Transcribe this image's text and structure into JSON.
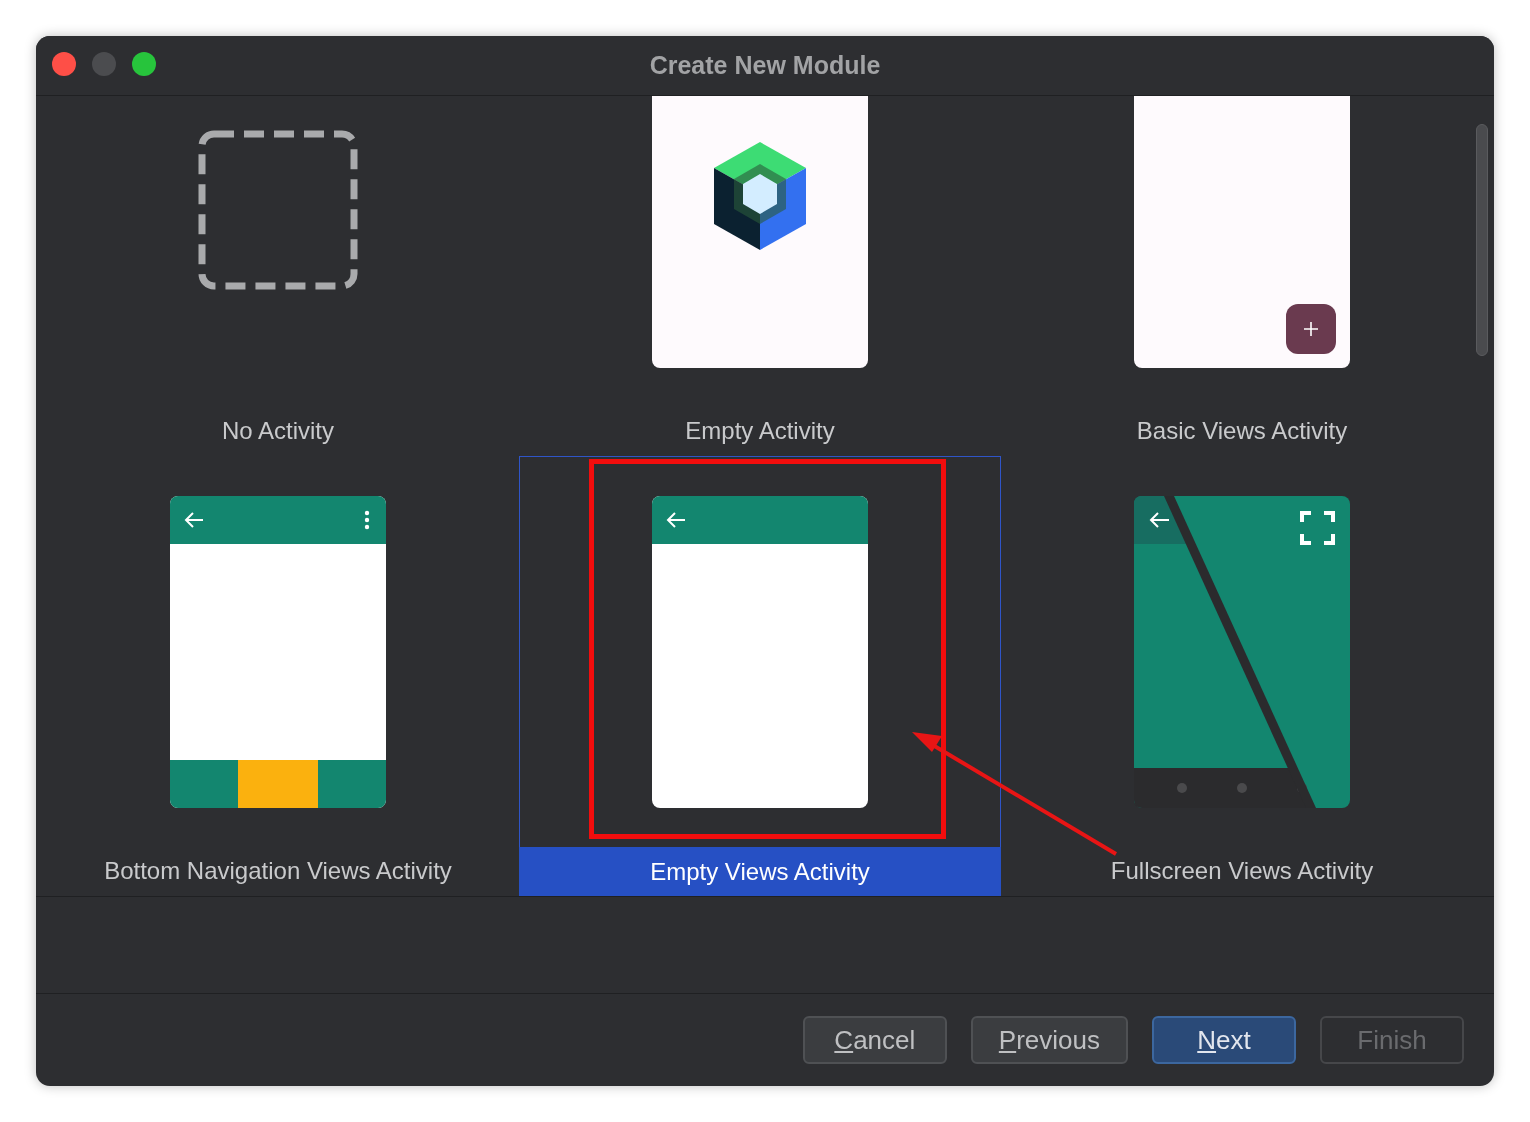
{
  "window": {
    "title": "Create New Module"
  },
  "templates": [
    {
      "name": "No Activity",
      "kind": "none",
      "selected": false
    },
    {
      "name": "Empty Activity",
      "kind": "compose",
      "selected": false
    },
    {
      "name": "Basic Views Activity",
      "kind": "fab",
      "selected": false
    },
    {
      "name": "Bottom Navigation Views Activity",
      "kind": "bottom-nav",
      "selected": false
    },
    {
      "name": "Empty Views Activity",
      "kind": "app-bar",
      "selected": true
    },
    {
      "name": "Fullscreen Views Activity",
      "kind": "fullscreen",
      "selected": false
    }
  ],
  "buttons": [
    {
      "label": "Cancel",
      "mnemonic": true,
      "default": false,
      "disabled": false
    },
    {
      "label": "Previous",
      "mnemonic": true,
      "default": false,
      "disabled": false
    },
    {
      "label": "Next",
      "mnemonic": true,
      "default": true,
      "disabled": false
    },
    {
      "label": "Finish",
      "mnemonic": false,
      "default": false,
      "disabled": true
    }
  ]
}
